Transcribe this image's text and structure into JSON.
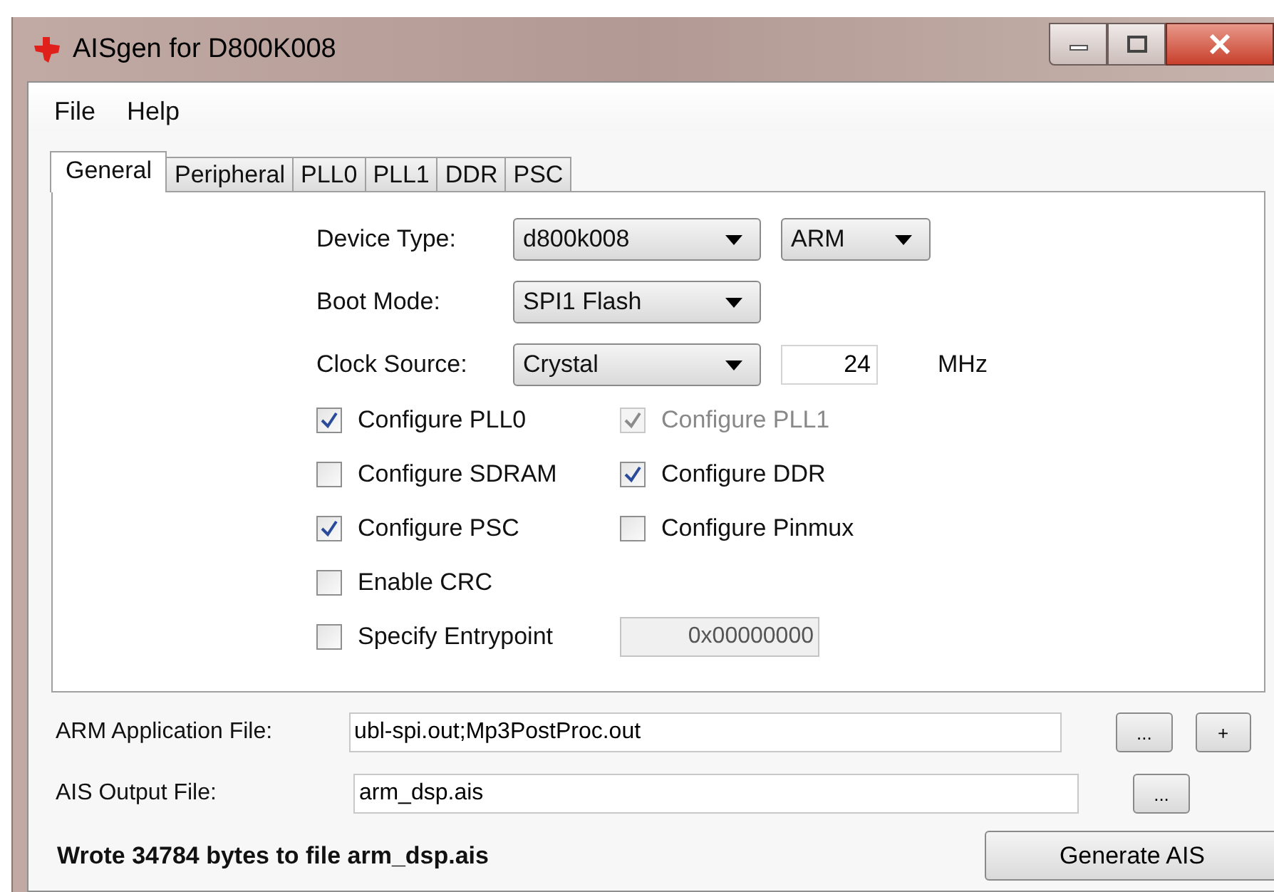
{
  "window": {
    "title": "AISgen for D800K008"
  },
  "menu": [
    "File",
    "Help"
  ],
  "tabs": [
    {
      "label": "General",
      "selected": true
    },
    {
      "label": "Peripheral",
      "selected": false
    },
    {
      "label": "PLL0",
      "selected": false
    },
    {
      "label": "PLL1",
      "selected": false
    },
    {
      "label": "DDR",
      "selected": false
    },
    {
      "label": "PSC",
      "selected": false
    }
  ],
  "settings": [
    {
      "label": "Device Type:",
      "kind": "combo",
      "value": "d800k008",
      "extra": {
        "kind": "combo",
        "value": "ARM"
      }
    },
    {
      "label": "Boot Mode:",
      "kind": "combo",
      "value": "SPI1 Flash"
    },
    {
      "label": "Clock Source:",
      "kind": "combo",
      "value": "Crystal",
      "extra": {
        "kind": "number",
        "value": "24",
        "unit": "MHz"
      }
    }
  ],
  "option_rows": [
    {
      "left": {
        "label": "Configure PLL0",
        "checked": true,
        "disabled": false
      },
      "right": {
        "kind": "checkbox",
        "label": "Configure PLL1",
        "checked": true,
        "disabled": true
      }
    },
    {
      "left": {
        "label": "Configure SDRAM",
        "checked": false,
        "disabled": false
      },
      "right": {
        "kind": "checkbox",
        "label": "Configure DDR",
        "checked": true,
        "disabled": false
      }
    },
    {
      "left": {
        "label": "Configure PSC",
        "checked": true,
        "disabled": false
      },
      "right": {
        "kind": "checkbox",
        "label": "Configure Pinmux",
        "checked": false,
        "disabled": false
      }
    },
    {
      "left": {
        "label": "Enable CRC",
        "checked": false,
        "disabled": false
      }
    },
    {
      "left": {
        "label": "Specify Entrypoint",
        "checked": false,
        "disabled": false
      },
      "right": {
        "kind": "field",
        "value": "0x00000000",
        "disabled": true
      }
    }
  ],
  "files": [
    {
      "label": "ARM Application File:",
      "value": "ubl-spi.out;Mp3PostProc.out",
      "buttons": [
        "...",
        "+"
      ]
    },
    {
      "label": "AIS Output File:",
      "value": "arm_dsp.ais",
      "buttons": [
        "..."
      ]
    }
  ],
  "status": "Wrote 34784 bytes to file arm_dsp.ais",
  "generate_button": "Generate AIS"
}
